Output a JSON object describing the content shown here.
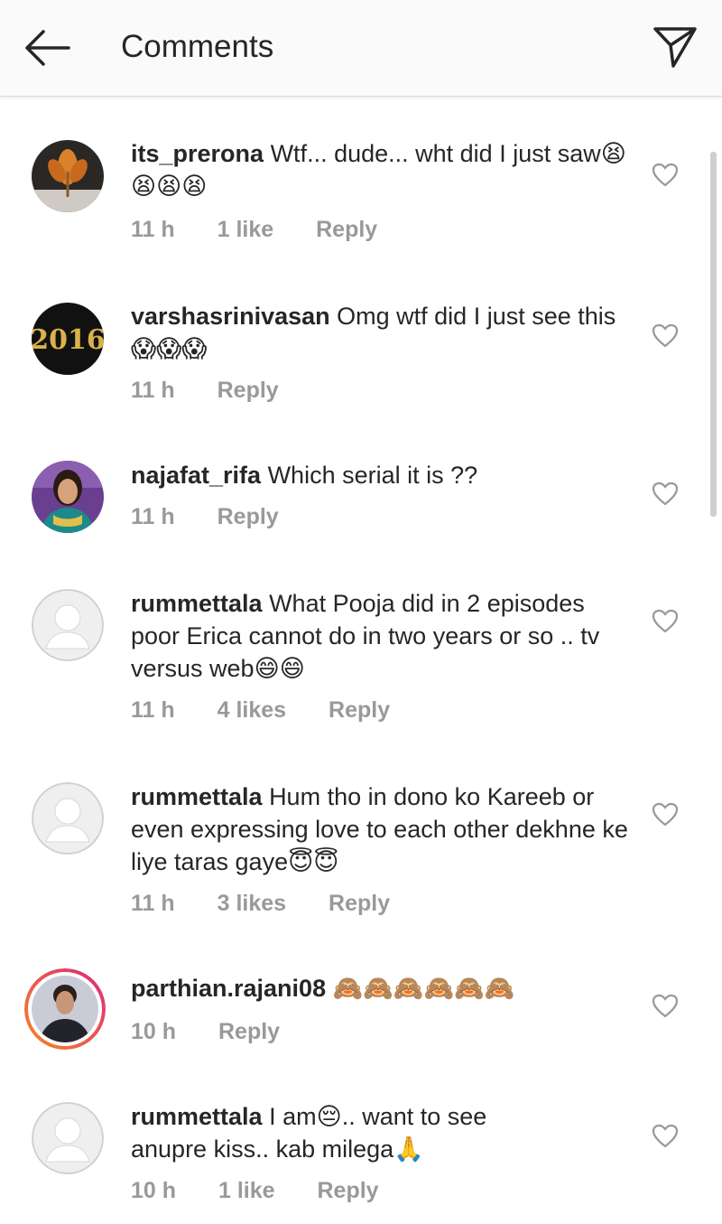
{
  "header": {
    "title": "Comments",
    "back_icon": "arrow-left-icon",
    "direct_icon": "paper-plane-icon"
  },
  "comments": [
    {
      "username": "its_prerona",
      "text": "Wtf... dude... wht did I just saw",
      "emojis": "😫😫😫😫",
      "time": "11 h",
      "likes": "1 like",
      "reply": "Reply",
      "avatar": "autumn-leaf-photo",
      "avatar_text": ""
    },
    {
      "username": "varshasrinivasan",
      "text": "Omg wtf did I just see this",
      "emojis": "😱😱😱",
      "time": "11 h",
      "likes": "",
      "reply": "Reply",
      "avatar": "year-2016-graphic",
      "avatar_text": "2016"
    },
    {
      "username": "najafat_rifa",
      "text": "Which serial it is ??",
      "emojis": "",
      "time": "11 h",
      "likes": "",
      "reply": "Reply",
      "avatar": "woman-portrait-photo",
      "avatar_text": ""
    },
    {
      "username": "rummettala",
      "text": "What Pooja did in 2 episodes poor Erica cannot do in two years or so .. tv versus web",
      "emojis": "😄😄",
      "time": "11 h",
      "likes": "4 likes",
      "reply": "Reply",
      "avatar": "default-user-avatar",
      "avatar_text": ""
    },
    {
      "username": "rummettala",
      "text": "Hum tho in dono ko Kareeb or even expressing love to each other dekhne ke liye taras gaye",
      "emojis": "😇😇",
      "time": "11 h",
      "likes": "3 likes",
      "reply": "Reply",
      "avatar": "default-user-avatar",
      "avatar_text": ""
    },
    {
      "username": "parthian.rajani08",
      "text": "",
      "emojis": "🙈🙈🙈🙈🙈🙈",
      "time": "10 h",
      "likes": "",
      "reply": "Reply",
      "avatar": "man-portrait-story-ring",
      "avatar_text": ""
    },
    {
      "username": "rummettala",
      "text": "I am",
      "text_after": ".. want to see anupre kiss.. kab milega",
      "emojis": "😔",
      "emojis_after": "🙏",
      "time": "10 h",
      "likes": "1 like",
      "reply": "Reply",
      "avatar": "default-user-avatar",
      "avatar_text": ""
    }
  ],
  "colors": {
    "text": "#262626",
    "meta": "#999999",
    "header_bg": "#fafafa",
    "story_ring_start": "#f58529",
    "story_ring_end": "#dd2a7b"
  }
}
